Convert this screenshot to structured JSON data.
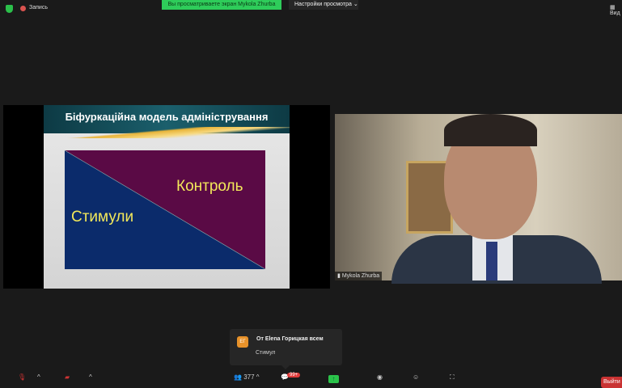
{
  "topbar": {
    "record_label": "Запись",
    "viewing_banner": "Вы просматриваете экран Mykola Zhurba",
    "view_options": "Настройки просмотра",
    "view_button": "Вид"
  },
  "slide": {
    "title": "Біфуркаційна модель адміністрування",
    "label_top": "Контроль",
    "label_bottom": "Стимули",
    "colors": {
      "top": "#5a0a45",
      "bottom": "#0b2b6b"
    }
  },
  "video": {
    "participant_name": "Mykola Zhurba"
  },
  "chat_popup": {
    "avatar_initials": "ЕГ",
    "from": "От Elena Горицкая всем",
    "message": "Стимул"
  },
  "toolbar": {
    "participants_count": "377",
    "chat_badge": "99+",
    "exit_label": "Выйти"
  }
}
